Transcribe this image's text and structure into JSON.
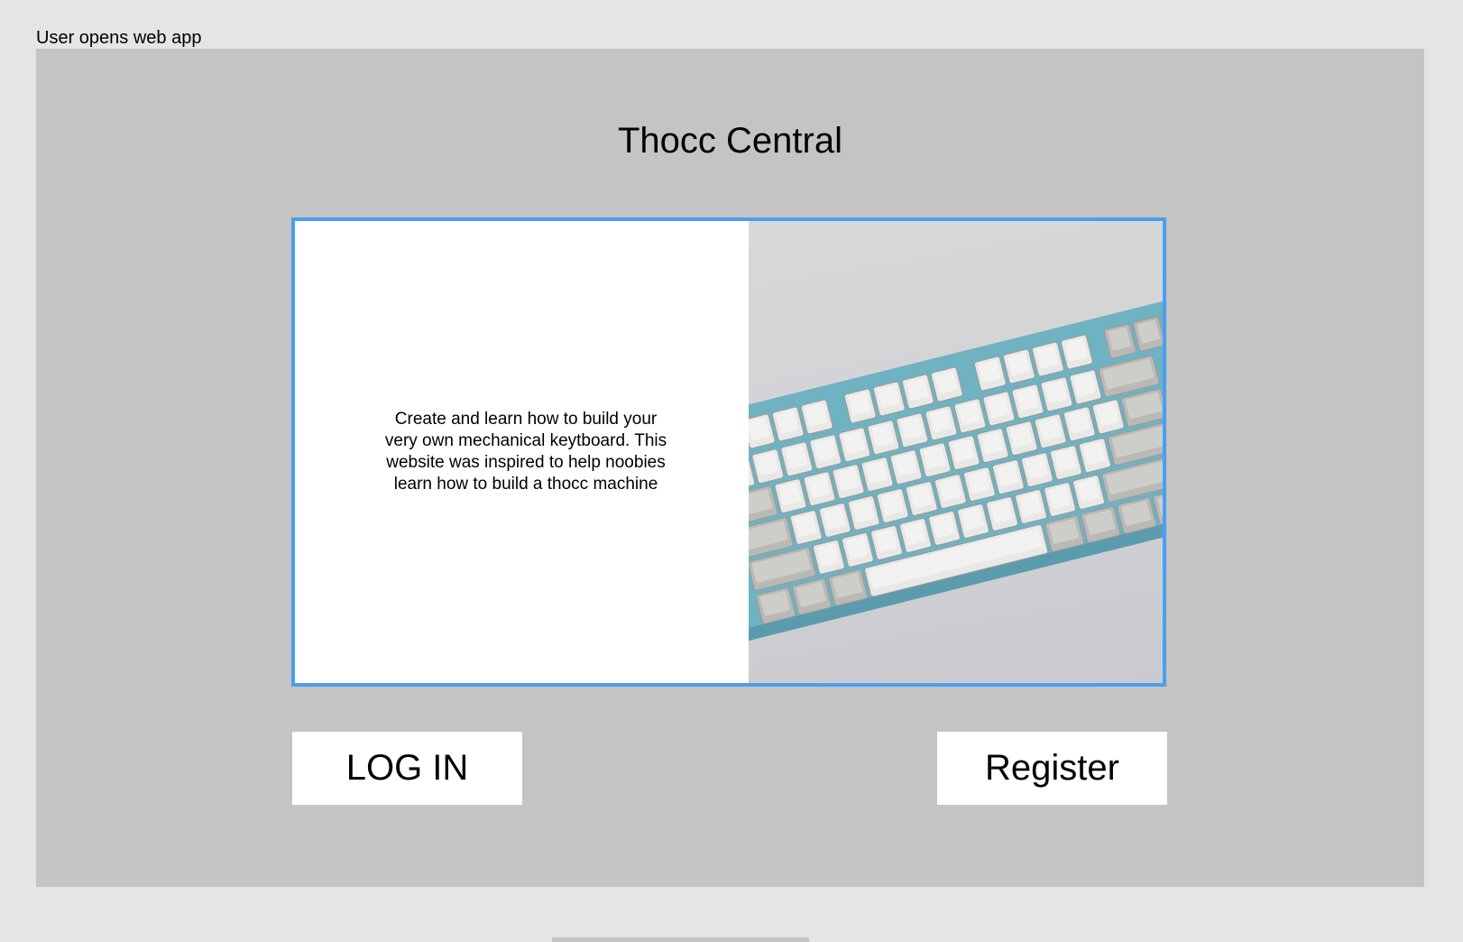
{
  "frame": {
    "label": "User opens web app"
  },
  "app": {
    "title": "Thocc Central"
  },
  "hero": {
    "description": "Create and learn how to build your very own mechanical keytboard. This website was inspired to help noobies learn how to build a thocc machine",
    "image_subject": "mechanical-keyboard-photo"
  },
  "actions": {
    "login_label": "LOG IN",
    "register_label": "Register"
  },
  "colors": {
    "canvas": "#e5e5e5",
    "frame_bg": "#c4c4c4",
    "card_border": "#4a9ff0",
    "keyboard_case": "#6fb2c2",
    "keycap": "#e8e8e6",
    "modifier_keycap": "#b9b9b6"
  }
}
